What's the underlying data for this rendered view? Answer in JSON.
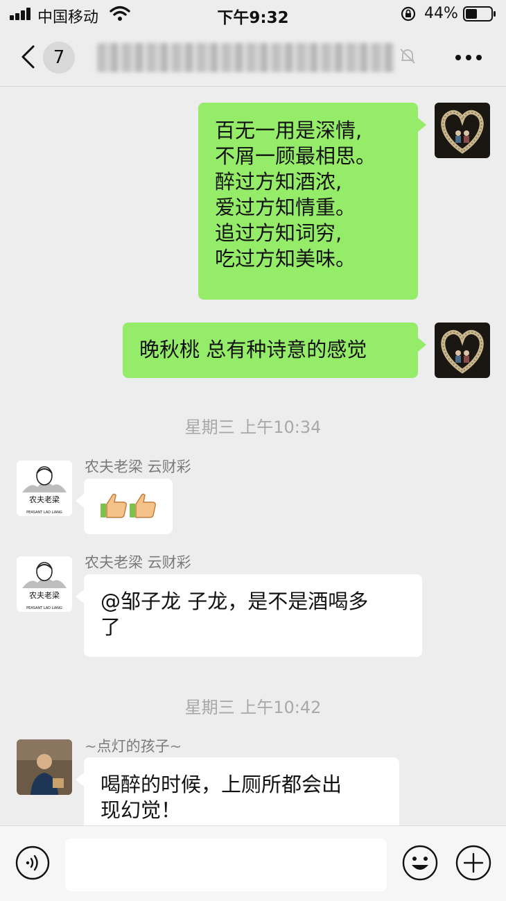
{
  "status_bar": {
    "carrier": "中国移动",
    "time": "下午9:32",
    "battery": "44%"
  },
  "nav": {
    "unread_count": "7",
    "title": "",
    "icons": [
      "back-chevron-icon",
      "mute-bell-icon",
      "more-icon"
    ]
  },
  "messages": {
    "m1": {
      "lines": [
        "百无一用是深情,",
        "不屑一顾最相思。",
        "醉过方知酒浓,",
        "爱过方知情重。",
        "追过方知词穷,",
        "吃过方知美味。"
      ]
    },
    "m2": {
      "text": "晚秋桃 总有种诗意的感觉"
    },
    "ts1": "星期三 上午10:34",
    "m3": {
      "sender": "农夫老梁  云财彩",
      "content": "thumbs-up-icon x2"
    },
    "m4": {
      "sender": "农夫老梁  云财彩",
      "lines": [
        "@邹子龙 子龙，是不是酒喝多",
        "了"
      ]
    },
    "ts2": "星期三 上午10:42",
    "m5": {
      "sender": "点灯的孩子",
      "lines": [
        "喝醉的时候，上厕所都会出",
        "现幻觉！"
      ]
    }
  },
  "avatars": {
    "farmer_text": "农夫老梁",
    "farmer_subtext": "PEASANT LAO LIANG"
  },
  "input_bar": {
    "placeholder": "",
    "icons": [
      "voice-icon",
      "emoji-icon",
      "plus-icon"
    ]
  },
  "colors": {
    "background": "#ededed",
    "my_bubble": "#95ec69",
    "other_bubble": "#ffffff",
    "muted_text": "#a8a8a8"
  }
}
